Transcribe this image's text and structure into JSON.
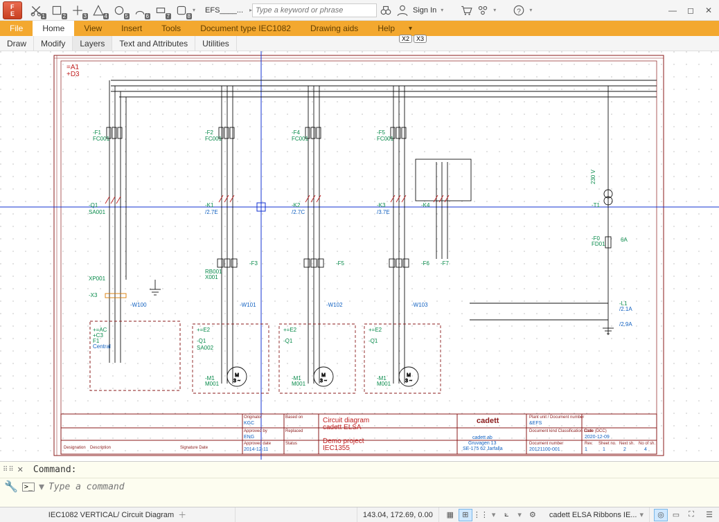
{
  "titlebar": {
    "efs_label": "EFS____...",
    "search_placeholder": "Type a keyword or phrase",
    "sign_in": "Sign In"
  },
  "ribbon": {
    "tabs": [
      "File",
      "Home",
      "View",
      "Insert",
      "Tools",
      "Document type IEC1082",
      "Drawing aids",
      "Help"
    ],
    "active": "Home"
  },
  "subtabs": {
    "items": [
      "Draw",
      "Modify",
      "Layers",
      "Text and Attributes",
      "Utilities"
    ],
    "active": "Layers"
  },
  "pills": {
    "x2": "X2",
    "x3": "X3"
  },
  "drawing": {
    "ref_a": "=A1",
    "ref_b": "+D3",
    "fuses": [
      "-F1",
      "-F2",
      "-F4",
      "-F5",
      "-F6"
    ],
    "fuse_sub": "FC001",
    "contactors": {
      "q1": "-Q1",
      "k1": "-K1",
      "k2": "-K2",
      "k3": "-K3",
      "k4": "-K4",
      "t1": "-T1"
    },
    "sa": "SA001",
    "wires": [
      "-W100",
      "-W101",
      "-W102",
      "-W103"
    ],
    "xp": "XP001",
    "x3": "-X3",
    "motors": [
      "-M1",
      "-M1",
      "-M1"
    ],
    "motor_sub": "M001",
    "ac": "+=AC",
    "c3": "+C3",
    "f1": "F1",
    "central": "Central",
    "f_prot": [
      "-F3",
      "-F5",
      "-F6",
      "-F7"
    ],
    "rb": "RB001",
    "x0": "X001",
    "q1box": "-Q1",
    "sa2": "SA002",
    "e2": "+=E2",
    "fd": "-F0",
    "fd_sub": "FD01",
    "fd_amp": "6A",
    "l1": "-L1",
    "l1_sub": "/2.1A",
    "l2_sub": "/2.9A",
    "volt": "230 V"
  },
  "titleblock": {
    "col1": {
      "originator": "Originator",
      "originator_v": "KGC",
      "approved": "Approved by",
      "approved_v": "ENG",
      "designation": "Designation",
      "description": "Description"
    },
    "col2": {
      "based": "Based on",
      "replaced": "Replaced",
      "appdate": "Approved date",
      "appdate_v": "2014-12-11",
      "sigdate": "Signature Date"
    },
    "col3": {
      "status": "Status"
    },
    "main1": "Circuit diagram",
    "main2": "cadett ELSA",
    "main3": "Demo project",
    "main4": "IEC1355",
    "company1": "cadett ab",
    "company2": "Gruvagen 13",
    "company3": "SE-175 62 Jarfalla",
    "r1": "Plant unit / Document number",
    "r1v": "&EFS",
    "r2": "Document kind Classification Code (DCC)",
    "r3": "Document number",
    "r3v": "20121100-001",
    "date_l": "Date",
    "date_v": "2020-12-09",
    "rev": "Rev.",
    "rev_v": "1",
    "sheet": "Sheet no.",
    "sheet_v": "1",
    "next": "Next sh.",
    "next_v": "2",
    "total": "No of sh.",
    "total_v": "4"
  },
  "command": {
    "label": "Command:",
    "placeholder": "Type a command"
  },
  "statusbar": {
    "doc": "IEC1082 VERTICAL/ Circuit Diagram",
    "coords": "143.04, 172.69, 0.00",
    "ribbons": "cadett ELSA Ribbons IE..."
  }
}
